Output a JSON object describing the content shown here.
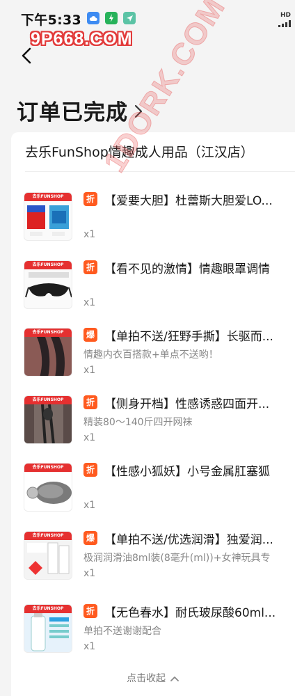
{
  "status_bar": {
    "time": "下午5:33",
    "hd_label": "HD",
    "icons": [
      "cloud-icon",
      "leaf-icon",
      "send-icon"
    ]
  },
  "watermark": {
    "top_text": "9P668.COM",
    "diagonal_text": "1DORK.COM"
  },
  "header": {
    "back_icon": "back-arrow-icon",
    "title": "订单已完成",
    "title_icon": "chevron-right-icon"
  },
  "order": {
    "shop_name": "去乐FunShop情趣成人用品（江汉店）",
    "items": [
      {
        "tag": "折",
        "tag_color": "#ff5a1f",
        "title": "【爱要大胆】杜蕾斯大胆爱LO...",
        "subtitle": "",
        "qty": "x1",
        "thumb_brand": "去乐FUNSHOP"
      },
      {
        "tag": "折",
        "tag_color": "#ff5a1f",
        "title": "【看不见的激情】情趣眼罩调情",
        "subtitle": "",
        "qty": "x1",
        "thumb_brand": "去乐FUNSHOP"
      },
      {
        "tag": "爆",
        "tag_color": "#ff5a1f",
        "title": "【单拍不送/狂野手撕】长驱而...",
        "subtitle": "情趣内衣百搭款+单点不送哟！",
        "qty": "x1",
        "thumb_brand": "去乐FUNSHOP"
      },
      {
        "tag": "折",
        "tag_color": "#ff5a1f",
        "title": "【侧身开档】性感诱惑四面开...",
        "subtitle": "精装80～140斤四开网袜",
        "qty": "x1",
        "thumb_brand": "去乐FUNSHOP"
      },
      {
        "tag": "折",
        "tag_color": "#ff5a1f",
        "title": "【性感小狐妖】小号金属肛塞狐",
        "subtitle": "",
        "qty": "x1",
        "thumb_brand": "去乐FUNSHOP"
      },
      {
        "tag": "爆",
        "tag_color": "#ff5a1f",
        "title": "【单拍不送/优选润滑】独爱润...",
        "subtitle": "极润润滑油8ml装(8毫升(ml))+女神玩具专",
        "qty": "x1",
        "thumb_brand": "去乐FUNSHOP"
      },
      {
        "tag": "折",
        "tag_color": "#ff5a1f",
        "title": "【无色春水】耐氏玻尿酸60ml...",
        "subtitle": "单拍不送谢谢配合",
        "qty": "x1",
        "thumb_brand": "去乐FUNSHOP"
      }
    ],
    "collapse_label": "点击收起",
    "collapse_icon": "chevron-up-icon"
  }
}
